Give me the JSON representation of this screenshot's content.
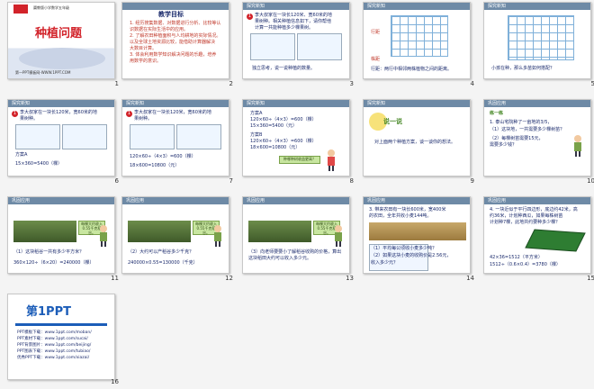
{
  "slides": [
    {
      "num": "1",
      "subtitle": "冀教版小学数学五年级",
      "title": "种植问题",
      "footer": "第一PPT模板网-WWW.1PPT.COM"
    },
    {
      "num": "2",
      "heading": "教学目标",
      "lines": [
        "1. 经历搜集数据、对数据进行分析、比较等认",
        "识数据在实际生活中的应用。",
        "2. 了解农田种植面积与人均耕地的实际情况。",
        "以及全球土地资源比较，能借助计算器解决",
        "大数目计算。",
        "3. 体会利用数学知识解决问题的乐趣，培养",
        "用数学的意识。"
      ]
    },
    {
      "num": "3",
      "header": "探究新知",
      "lines": [
        "李大叔家在一块长120米、宽60米的地",
        "果树种。相关种植信息如下，请你帮他",
        "计算一共能种植多少棵果树。"
      ],
      "bottom": "独立思考，说一说种植的数量。"
    },
    {
      "num": "4",
      "header": "探究新知",
      "labels": [
        "行距",
        "株距"
      ],
      "bottom": "行距：两行中相邻两株植物之间的距离。"
    },
    {
      "num": "5",
      "header": "探究新知",
      "q": "小孩在种，那么多苗如何搭配？"
    },
    {
      "num": "6",
      "header": "探究新知",
      "lines": [
        "李大叔家在一块长120米，宽60米的地",
        "果树种。"
      ],
      "plan": "方案A",
      "formula": "15×360=5400（棵）"
    },
    {
      "num": "7",
      "header": "探究新知",
      "lines": [
        "李大叔家在一块长120米，宽60米的地",
        "果树种。"
      ],
      "f1": "120×60÷（4×3）=600（棵）",
      "f2": "18×600=10800（元）"
    },
    {
      "num": "8",
      "header": "探究新知",
      "lines": [
        "方案A",
        "120×60÷（4×3）=600（棵）",
        "15×360=5400（元）",
        "方案B",
        "120×60÷（4×3）=600（棵）",
        "18×600=10800（元）"
      ],
      "bubble": "种哪种树收益更高？"
    },
    {
      "num": "9",
      "header": "探究新知",
      "tag": "说一说",
      "line": "对上面两个种植方案，谈一谈你的想法。"
    },
    {
      "num": "10",
      "header": "巩固应用",
      "tag": "练一练",
      "lines": [
        "1. 泰山宅院种了一亩地的3/5，",
        "（1）这块地，一共需要多少棵树苗？",
        "（2）每棵树苗需要15元，",
        "需要多少钱？"
      ]
    },
    {
      "num": "11",
      "header": "巩固应用",
      "q": "（1）这块稻谷一共有多少平方米？",
      "ans": "360×120÷（6×20）=240000（棵）",
      "sign": "每棵大约收入0.55千克稻谷。"
    },
    {
      "num": "12",
      "header": "巩固应用",
      "q": "（2）大约可以产稻谷多少千克？",
      "ans": "240000×0.55=130000（千克）",
      "sign": "每棵大约收入0.55千克稻谷。"
    },
    {
      "num": "13",
      "header": "巩固应用",
      "q": "（3）向老师要要小了解稻谷收购的价格，算出这块稻田大约可以收入多少元。",
      "sign": "每棵大约收入0.55千克稻谷。"
    },
    {
      "num": "14",
      "header": "巩固应用",
      "lines": [
        "3. 带来农田有一块长600米，宽400米",
        "的农田，全年共收小麦144吨。"
      ],
      "qs": [
        "（1）平均每公顷收小麦多少吨？",
        "（2）如果这块小麦的收购价是2.56元，",
        "收入多少元？"
      ]
    },
    {
      "num": "15",
      "header": "巩固应用",
      "lines": [
        "4. 一块近似于平行四边形，底边约42米，高",
        "约36米，计划种西瓜，如果每株树苗",
        "计划种7棵，此地共约要种多少棵？"
      ],
      "f1": "42×36=1512（平方米）",
      "f2": "1512÷（0.6×0.4）=3780（棵）"
    },
    {
      "num": "16",
      "brand": "第1PPT",
      "rows": [
        "PPT模板下载：www.1ppt.com/moban/",
        "PPT素材下载：www.1ppt.com/sucai/",
        "PPT背景图片：www.1ppt.com/beijing/",
        "PPT图表下载：www.1ppt.com/tubiao/",
        "优秀PPT下载：www.1ppt.com/xiazai/"
      ]
    }
  ],
  "colors": {
    "accent": "#d2232a",
    "header": "#6e8aa6",
    "text": "#1a2a6c"
  }
}
